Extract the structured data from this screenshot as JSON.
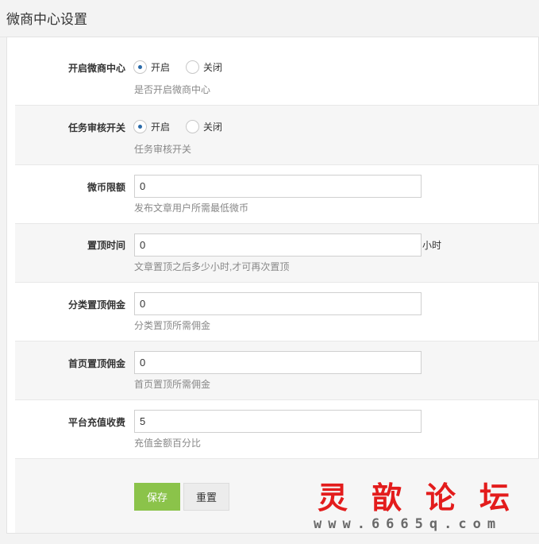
{
  "page_title": "微商中心设置",
  "form": {
    "enable_center": {
      "label": "开启微商中心",
      "option_on": "开启",
      "option_off": "关闭",
      "selected": "开启",
      "hint": "是否开启微商中心"
    },
    "task_review": {
      "label": "任务审核开关",
      "option_on": "开启",
      "option_off": "关闭",
      "selected": "开启",
      "hint": "任务审核开关"
    },
    "coin_limit": {
      "label": "微币限额",
      "value": "0",
      "hint": "发布文章用户所需最低微币"
    },
    "pin_time": {
      "label": "置顶时间",
      "value": "0",
      "suffix": "小时",
      "hint": "文章置顶之后多少小时,才可再次置顶"
    },
    "category_pin_fee": {
      "label": "分类置顶佣金",
      "value": "0",
      "hint": "分类置顶所需佣金"
    },
    "home_pin_fee": {
      "label": "首页置顶佣金",
      "value": "0",
      "hint": "首页置顶所需佣金"
    },
    "recharge_fee": {
      "label": "平台充值收费",
      "value": "5",
      "hint": "充值金额百分比"
    }
  },
  "actions": {
    "save_label": "保存",
    "reset_label": "重置"
  },
  "watermark": {
    "text": "灵歆论坛",
    "url": "www.6665q.com"
  }
}
